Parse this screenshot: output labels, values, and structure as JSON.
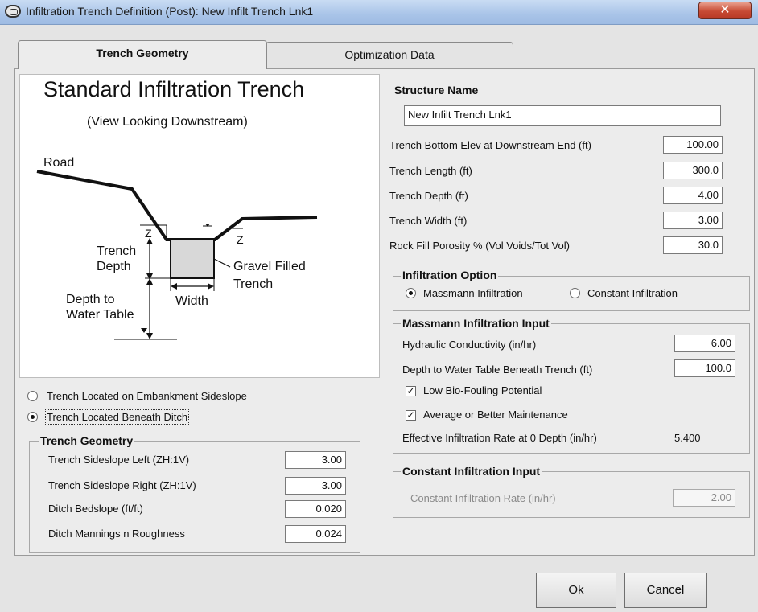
{
  "window": {
    "title": "Infiltration Trench Definition (Post): New Infilt Trench Lnk1",
    "close_glyph": "✕"
  },
  "tabs": [
    {
      "label": "Trench Geometry",
      "active": true
    },
    {
      "label": "Optimization Data",
      "active": false
    }
  ],
  "diagram": {
    "title": "Standard Infiltration Trench",
    "subtitle": "(View Looking Downstream)",
    "road": "Road",
    "trench_depth_1": "Trench",
    "trench_depth_2": "Depth",
    "gravel_1": "Gravel Filled",
    "gravel_2": "Trench",
    "depth_wt_1": "Depth to",
    "depth_wt_2": "Water Table",
    "width": "Width",
    "z_left": "Z",
    "z_right": "Z"
  },
  "location_options": [
    {
      "label": "Trench Located on Embankment Sideslope",
      "selected": false
    },
    {
      "label": "Trench Located Beneath Ditch",
      "selected": true
    }
  ],
  "trench_geometry": {
    "title": "Trench Geometry",
    "rows": [
      {
        "label": "Trench Sideslope Left (ZH:1V)",
        "value": "3.00"
      },
      {
        "label": "Trench Sideslope Right (ZH:1V)",
        "value": "3.00"
      },
      {
        "label": "Ditch Bedslope (ft/ft)",
        "value": "0.020"
      },
      {
        "label": "Ditch Mannings n Roughness",
        "value": "0.024"
      }
    ]
  },
  "structure": {
    "name_label": "Structure Name",
    "name_value": "New Infilt Trench Lnk1",
    "rows": [
      {
        "label": "Trench Bottom Elev at Downstream  End (ft)",
        "value": "100.00"
      },
      {
        "label": "Trench Length (ft)",
        "value": "300.0"
      },
      {
        "label": "Trench Depth (ft)",
        "value": "4.00"
      },
      {
        "label": "Trench Width (ft)",
        "value": "3.00"
      },
      {
        "label": "Rock Fill Porosity % (Vol Voids/Tot Vol)",
        "value": "30.0"
      }
    ]
  },
  "infiltration_option": {
    "title": "Infiltration Option",
    "options": [
      {
        "label": "Massmann Infiltration",
        "selected": true
      },
      {
        "label": "Constant Infiltration",
        "selected": false
      }
    ]
  },
  "massmann": {
    "title": "Massmann Infiltration Input",
    "hydraulic_label": "Hydraulic Conductivity (in/hr)",
    "hydraulic_value": "6.00",
    "depth_label": "Depth to Water Table Beneath Trench (ft)",
    "depth_value": "100.0",
    "biofouling_label": "Low Bio-Fouling Potential",
    "biofouling_checked": true,
    "maintenance_label": "Average or Better Maintenance",
    "maintenance_checked": true,
    "effective_label": "Effective Infiltration Rate at 0 Depth (in/hr)",
    "effective_value": "5.400"
  },
  "constant": {
    "title": "Constant Infiltration Input",
    "rate_label": "Constant Infiltration Rate (in/hr)",
    "rate_value": "2.00"
  },
  "buttons": {
    "ok": "Ok",
    "cancel": "Cancel"
  },
  "glyphs": {
    "check": "✓"
  }
}
